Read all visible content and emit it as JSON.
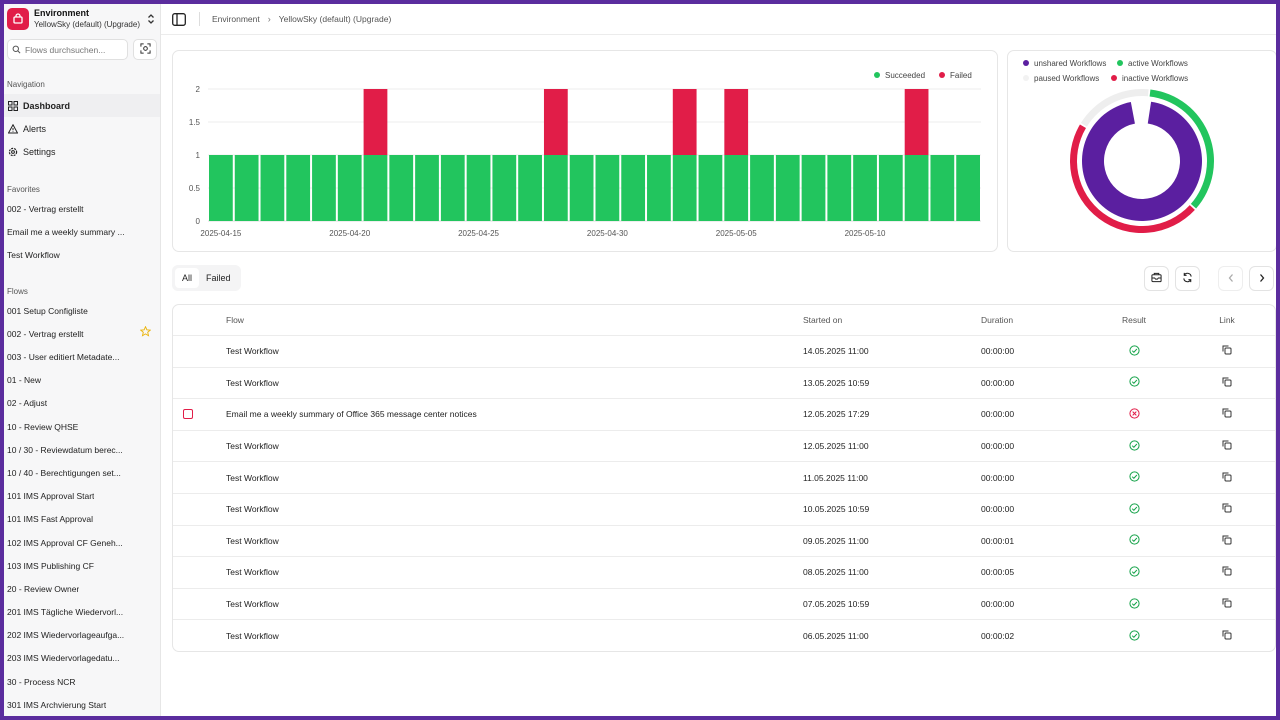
{
  "environment": {
    "title": "Environment",
    "subtitle": "YellowSky (default) (Upgrade)"
  },
  "search": {
    "placeholder": "Flows durchsuchen..."
  },
  "navigation": {
    "title": "Navigation",
    "items": [
      {
        "label": "Dashboard",
        "icon": "dashboard-icon",
        "active": true
      },
      {
        "label": "Alerts",
        "icon": "alert-icon"
      },
      {
        "label": "Settings",
        "icon": "gear-icon"
      }
    ]
  },
  "favorites": {
    "title": "Favorites",
    "items": [
      "002 - Vertrag erstellt",
      "Email me a weekly summary ...",
      "Test Workflow"
    ]
  },
  "flows": {
    "title": "Flows",
    "items": [
      "001 Setup Configliste",
      "002 - Vertrag erstellt",
      "003 - User editiert Metadate...",
      "01 - New",
      "02 - Adjust",
      "10 - Review QHSE",
      "10 / 30 - Reviewdatum berec...",
      "10 / 40 - Berechtigungen set...",
      "101 IMS Approval Start",
      "101 IMS Fast Approval",
      "102 IMS Approval CF Geneh...",
      "103 IMS Publishing CF",
      "20 - Review Owner",
      "201 IMS Tägliche Wiedervorl...",
      "202 IMS Wiedervorlageaufga...",
      "203 IMS Wiedervorlagedatu...",
      "30 - Process NCR",
      "301 IMS Archvierung Start"
    ]
  },
  "breadcrumb": {
    "root": "Environment",
    "current": "YellowSky (default) (Upgrade)"
  },
  "colors": {
    "succeeded": "#22c55e",
    "failed": "#e11d48",
    "unshared": "#5b1fa0",
    "paused": "#eeeeee",
    "accent": "#5b2d9e"
  },
  "chart_data": [
    {
      "type": "bar",
      "stacked": true,
      "x_start": "2025-04-15",
      "categories": [
        "2025-04-15",
        "2025-04-16",
        "2025-04-17",
        "2025-04-18",
        "2025-04-19",
        "2025-04-20",
        "2025-04-21",
        "2025-04-22",
        "2025-04-23",
        "2025-04-24",
        "2025-04-25",
        "2025-04-26",
        "2025-04-27",
        "2025-04-28",
        "2025-04-29",
        "2025-04-30",
        "2025-05-01",
        "2025-05-02",
        "2025-05-03",
        "2025-05-04",
        "2025-05-05",
        "2025-05-06",
        "2025-05-07",
        "2025-05-08",
        "2025-05-09",
        "2025-05-10",
        "2025-05-11",
        "2025-05-12",
        "2025-05-13",
        "2025-05-14"
      ],
      "xticks": [
        "2025-04-15",
        "2025-04-20",
        "2025-04-25",
        "2025-04-30",
        "2025-05-05",
        "2025-05-10"
      ],
      "yticks": [
        "0",
        "0.5",
        "1",
        "1.5",
        "2"
      ],
      "ylim": [
        0,
        2
      ],
      "grid": true,
      "legend": "top-right",
      "series": [
        {
          "name": "Succeeded",
          "color": "#22c55e",
          "values": [
            1,
            1,
            1,
            1,
            1,
            1,
            1,
            1,
            1,
            1,
            1,
            1,
            1,
            1,
            1,
            1,
            1,
            1,
            1,
            1,
            1,
            1,
            1,
            1,
            1,
            1,
            1,
            1,
            1,
            1
          ]
        },
        {
          "name": "Failed",
          "color": "#e11d48",
          "values": [
            0,
            0,
            0,
            0,
            0,
            0,
            1,
            0,
            0,
            0,
            0,
            0,
            0,
            1,
            0,
            0,
            0,
            0,
            1,
            0,
            1,
            0,
            0,
            0,
            0,
            0,
            0,
            1,
            0,
            0
          ]
        }
      ]
    },
    {
      "type": "pie",
      "legend": "top",
      "rings": [
        {
          "name": "inner",
          "slices": [
            {
              "label": "unshared Workflows",
              "value": 95,
              "color": "#5b1fa0"
            },
            {
              "label": "shared",
              "value": 5,
              "color": "#ffffff"
            }
          ]
        },
        {
          "name": "outer",
          "slices": [
            {
              "label": "active Workflows",
              "value": 35,
              "color": "#22c55e"
            },
            {
              "label": "inactive Workflows",
              "value": 47,
              "color": "#e11d48"
            },
            {
              "label": "paused Workflows",
              "value": 18,
              "color": "#eeeeee"
            }
          ]
        }
      ],
      "legend_labels": [
        "unshared Workflows",
        "active Workflows",
        "paused Workflows",
        "inactive Workflows"
      ]
    }
  ],
  "filters": {
    "all": "All",
    "failed": "Failed"
  },
  "table": {
    "headers": {
      "flow": "Flow",
      "started": "Started on",
      "duration": "Duration",
      "result": "Result",
      "link": "Link"
    },
    "rows": [
      {
        "flow": "Test Workflow",
        "started": "14.05.2025 11:00",
        "duration": "00:00:00",
        "result": "success",
        "selectable": false
      },
      {
        "flow": "Test Workflow",
        "started": "13.05.2025 10:59",
        "duration": "00:00:00",
        "result": "success",
        "selectable": false
      },
      {
        "flow": "Email me a weekly summary of Office 365 message center notices",
        "started": "12.05.2025 17:29",
        "duration": "00:00:00",
        "result": "failed",
        "selectable": true
      },
      {
        "flow": "Test Workflow",
        "started": "12.05.2025 11:00",
        "duration": "00:00:00",
        "result": "success",
        "selectable": false
      },
      {
        "flow": "Test Workflow",
        "started": "11.05.2025 11:00",
        "duration": "00:00:00",
        "result": "success",
        "selectable": false
      },
      {
        "flow": "Test Workflow",
        "started": "10.05.2025 10:59",
        "duration": "00:00:00",
        "result": "success",
        "selectable": false
      },
      {
        "flow": "Test Workflow",
        "started": "09.05.2025 11:00",
        "duration": "00:00:01",
        "result": "success",
        "selectable": false
      },
      {
        "flow": "Test Workflow",
        "started": "08.05.2025 11:00",
        "duration": "00:00:05",
        "result": "success",
        "selectable": false
      },
      {
        "flow": "Test Workflow",
        "started": "07.05.2025 10:59",
        "duration": "00:00:00",
        "result": "success",
        "selectable": false
      },
      {
        "flow": "Test Workflow",
        "started": "06.05.2025 11:00",
        "duration": "00:00:02",
        "result": "success",
        "selectable": false
      }
    ]
  }
}
